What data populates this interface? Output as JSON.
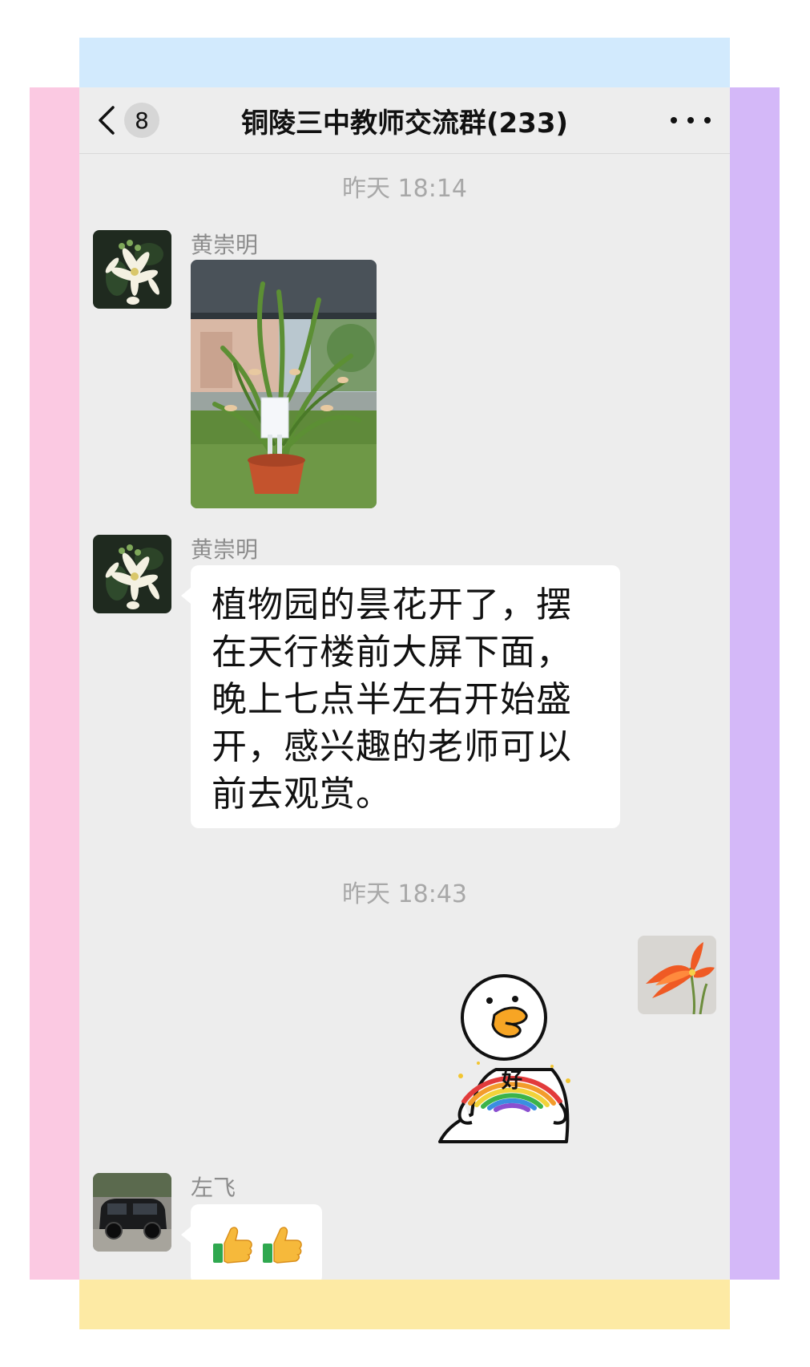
{
  "header": {
    "back_label": "<",
    "unread_count": "8",
    "title": "铜陵三中教师交流群(233)",
    "more_icon": "more-dots-icon"
  },
  "messages": [
    {
      "type": "timestamp",
      "text": "昨天 18:14"
    },
    {
      "type": "image",
      "sender": "黄崇明",
      "avatar": "flower-avatar"
    },
    {
      "type": "text",
      "sender": "黄崇明",
      "avatar": "flower-avatar",
      "lines": [
        "植物园的昙花开了，摆",
        "在天行楼前大屏下面，",
        "晚上七点半左右开始盛",
        "开，感兴趣的老师可以",
        "前去观赏。"
      ]
    },
    {
      "type": "timestamp",
      "text": "昨天 18:43"
    },
    {
      "type": "sticker",
      "sender": "self",
      "avatar": "clivia-avatar",
      "sticker_text": "好"
    },
    {
      "type": "emoji",
      "sender": "左飞",
      "avatar": "car-avatar",
      "emoji": [
        "thumbs-up-icon",
        "thumbs-up-icon"
      ]
    }
  ],
  "colors": {
    "chat_background": "#ededed",
    "bubble": "#ffffff",
    "band_top": "#d2eafd",
    "band_left": "#fbc9e2",
    "band_right": "#d4b8f8",
    "band_bottom": "#fdeaa4"
  }
}
